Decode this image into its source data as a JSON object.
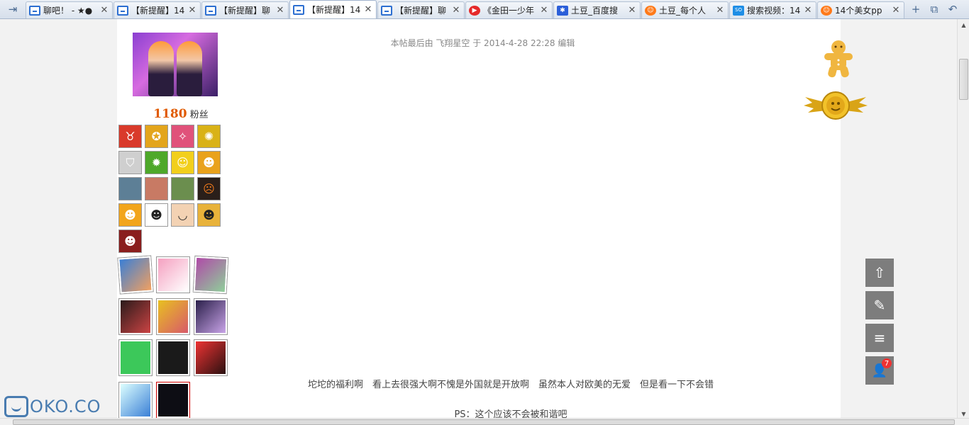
{
  "tabs": [
    {
      "title": "聊吧！ - ★●",
      "favicon": "chat-icon",
      "active": false
    },
    {
      "title": "【新提醒】14",
      "favicon": "chat-icon",
      "active": false
    },
    {
      "title": "【新提醒】聊",
      "favicon": "chat-icon",
      "active": false
    },
    {
      "title": "【新提醒】14",
      "favicon": "chat-icon",
      "active": true
    },
    {
      "title": "【新提醒】聊",
      "favicon": "chat-icon",
      "active": false
    },
    {
      "title": "《金田一少年",
      "favicon": "video-icon",
      "active": false
    },
    {
      "title": "土豆_百度搜",
      "favicon": "paw-icon",
      "active": false
    },
    {
      "title": "土豆_每个人",
      "favicon": "tudou-icon",
      "active": false
    },
    {
      "title": "搜索视频：14",
      "favicon": "soku-icon",
      "active": false
    },
    {
      "title": "14个美女pp",
      "favicon": "tudou-icon",
      "active": false
    }
  ],
  "tab_close_glyph": "✕",
  "nav_glyph": "⇥",
  "new_tab_glyph": "+",
  "profile": {
    "fans_count": "1180",
    "fans_label": "粉丝"
  },
  "post": {
    "edit_note": "本帖最后由 飞翔星空 于 2014-4-28 22:28 编辑",
    "line1": "坨坨的福利啊　看上去很强大啊不愧是外国就是开放啊　虽然本人对欧美的无爱　但是看一下不会错",
    "line2": "PS：这个应该不会被和谐吧"
  },
  "side_tools": [
    {
      "name": "back-to-top-icon",
      "glyph": "⇧"
    },
    {
      "name": "edit-post-icon",
      "glyph": "✎"
    },
    {
      "name": "menu-icon",
      "glyph": "≡"
    },
    {
      "name": "user-notify-icon",
      "glyph": "👤",
      "badge": "7"
    }
  ],
  "watermark": "OKO.CO",
  "colors": {
    "accent_fans": "#e05a00",
    "tool_bg": "#7d7d7d",
    "badge": "#ee3333"
  }
}
